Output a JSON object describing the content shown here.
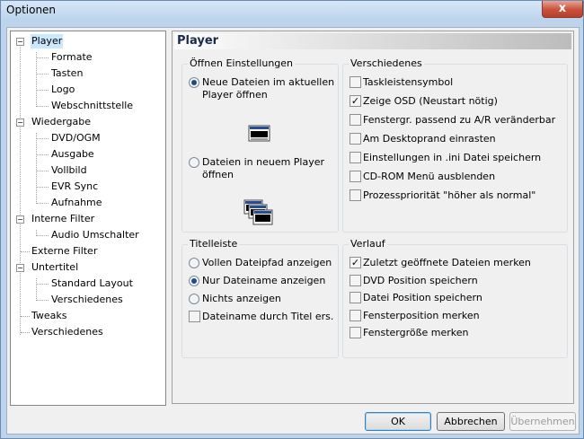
{
  "window": {
    "title": "Optionen",
    "close_glyph": "x"
  },
  "tree": {
    "items": [
      {
        "label": "Player",
        "level": 0,
        "selected": true
      },
      {
        "label": "Formate",
        "level": 1
      },
      {
        "label": "Tasten",
        "level": 1
      },
      {
        "label": "Logo",
        "level": 1
      },
      {
        "label": "Webschnittstelle",
        "level": 1
      },
      {
        "label": "Wiedergabe",
        "level": 0
      },
      {
        "label": "DVD/OGM",
        "level": 1
      },
      {
        "label": "Ausgabe",
        "level": 1
      },
      {
        "label": "Vollbild",
        "level": 1
      },
      {
        "label": "EVR Sync",
        "level": 1
      },
      {
        "label": "Aufnahme",
        "level": 1
      },
      {
        "label": "Interne Filter",
        "level": 0
      },
      {
        "label": "Audio Umschalter",
        "level": 1
      },
      {
        "label": "Externe Filter",
        "level": 0
      },
      {
        "label": "Untertitel",
        "level": 0
      },
      {
        "label": "Standard Layout",
        "level": 1
      },
      {
        "label": "Verschiedenes",
        "level": 1
      },
      {
        "label": "Tweaks",
        "level": 0
      },
      {
        "label": "Verschiedenes",
        "level": 0
      }
    ]
  },
  "page": {
    "title": "Player",
    "open_group": {
      "title": "Öffnen Einstellungen",
      "same_line1": "Neue Dateien im aktuellen",
      "same_line2": "Player öffnen",
      "new_line1": "Dateien in neuem Player",
      "new_line2": "öffnen",
      "selected": "same"
    },
    "misc_group": {
      "title": "Verschiedenes",
      "items": [
        {
          "label": "Taskleistensymbol",
          "checked": false
        },
        {
          "label": "Zeige OSD (Neustart nötig)",
          "checked": true
        },
        {
          "label": "Fenstergr. passend zu A/R veränderbar",
          "checked": false
        },
        {
          "label": "Am Desktoprand einrasten",
          "checked": false
        },
        {
          "label": "Einstellungen in .ini Datei speichern",
          "checked": false
        },
        {
          "label": "CD-ROM Menü ausblenden",
          "checked": false
        },
        {
          "label": "Prozesspriorität \"höher als normal\"",
          "checked": false
        }
      ]
    },
    "title_group": {
      "title": "Titelleiste",
      "options": [
        {
          "label": "Vollen Dateipfad anzeigen",
          "selected": false
        },
        {
          "label": "Nur Dateiname anzeigen",
          "selected": true
        },
        {
          "label": "Nichts anzeigen",
          "selected": false
        }
      ],
      "checkbox": {
        "label": "Dateiname durch Titel ers.",
        "checked": false
      }
    },
    "history_group": {
      "title": "Verlauf",
      "items": [
        {
          "label": "Zuletzt geöffnete Dateien merken",
          "checked": true
        },
        {
          "label": "DVD Position speichern",
          "checked": false
        },
        {
          "label": "Datei Position speichern",
          "checked": false
        },
        {
          "label": "Fensterposition merken",
          "checked": false
        },
        {
          "label": "Fenstergröße merken",
          "checked": false
        }
      ]
    }
  },
  "buttons": {
    "ok": "OK",
    "cancel": "Abbrechen",
    "apply": "Übernehmen"
  },
  "check_glyph": "✓"
}
